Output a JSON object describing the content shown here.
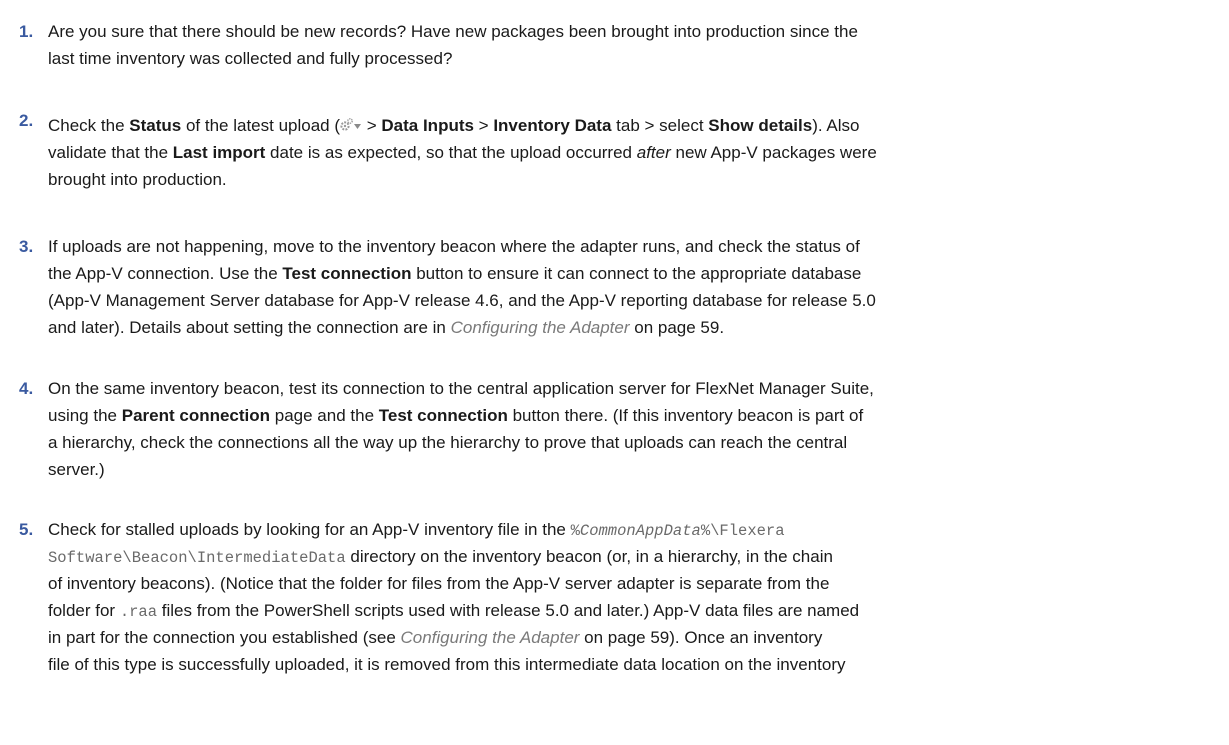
{
  "items": [
    {
      "num": "1.",
      "lines": [
        [
          {
            "t": "Are you sure that there should be new records? Have new packages been brought into production since the"
          }
        ],
        [
          {
            "t": "last time inventory was collected and fully processed?"
          }
        ]
      ]
    },
    {
      "num": "2.",
      "lines": [
        [
          {
            "t": "Check the "
          },
          {
            "t": "Status",
            "s": "b"
          },
          {
            "t": " of the latest upload ("
          },
          {
            "icon": "gear-dropdown-icon"
          },
          {
            "t": " > "
          },
          {
            "t": "Data Inputs",
            "s": "b"
          },
          {
            "t": " > "
          },
          {
            "t": "Inventory Data",
            "s": "b"
          },
          {
            "t": " tab > select "
          },
          {
            "t": "Show details",
            "s": "b"
          },
          {
            "t": "). Also"
          }
        ],
        [
          {
            "t": "validate that the "
          },
          {
            "t": "Last import",
            "s": "b"
          },
          {
            "t": " date is as expected, so that the upload occurred "
          },
          {
            "t": "after",
            "s": "i"
          },
          {
            "t": " new App-V packages were"
          }
        ],
        [
          {
            "t": "brought into production."
          }
        ]
      ]
    },
    {
      "num": "3.",
      "lines": [
        [
          {
            "t": "If uploads are not happening, move to the inventory beacon where the adapter runs, and check the status of"
          }
        ],
        [
          {
            "t": "the App-V connection. Use the "
          },
          {
            "t": "Test connection",
            "s": "b"
          },
          {
            "t": " button to ensure it can connect to the appropriate database"
          }
        ],
        [
          {
            "t": "(App-V Management Server database for App-V release 4.6, and the App-V reporting database for release 5.0"
          }
        ],
        [
          {
            "t": "and later). Details about setting the connection are in "
          },
          {
            "t": "Configuring the Adapter",
            "s": "x"
          },
          {
            "t": " on page 59."
          }
        ]
      ]
    },
    {
      "num": "4.",
      "lines": [
        [
          {
            "t": "On the same inventory beacon, test its connection to the central application server for FlexNet Manager Suite,"
          }
        ],
        [
          {
            "t": "using the "
          },
          {
            "t": "Parent connection",
            "s": "b"
          },
          {
            "t": " page and the "
          },
          {
            "t": "Test connection",
            "s": "b"
          },
          {
            "t": " button there. (If this inventory beacon is part of"
          }
        ],
        [
          {
            "t": "a hierarchy, check the connections all the way up the hierarchy to prove that uploads can reach the central"
          }
        ],
        [
          {
            "t": "server.)"
          }
        ]
      ]
    },
    {
      "num": "5.",
      "lines": [
        [
          {
            "t": "Check for stalled uploads by looking for an App-V inventory file in the "
          },
          {
            "t": "%",
            "s": "m"
          },
          {
            "t": "CommonAppData",
            "s": "mi"
          },
          {
            "t": "%\\Flexera",
            "s": "m"
          }
        ],
        [
          {
            "t": "Software\\Beacon\\IntermediateData",
            "s": "m"
          },
          {
            "t": " directory on the inventory beacon (or, in a hierarchy, in the chain"
          }
        ],
        [
          {
            "t": "of inventory beacons). (Notice that the folder for files from the App-V server adapter is separate from the"
          }
        ],
        [
          {
            "t": "folder for "
          },
          {
            "t": ".raa",
            "s": "m"
          },
          {
            "t": " files from the PowerShell scripts used with release 5.0 and later.) App-V data files are named"
          }
        ],
        [
          {
            "t": "in part for the connection you established (see "
          },
          {
            "t": "Configuring the Adapter",
            "s": "x"
          },
          {
            "t": " on page 59). Once an inventory"
          }
        ],
        [
          {
            "t": "file of this type is successfully uploaded, it is removed from this intermediate data location on the inventory"
          }
        ]
      ]
    }
  ]
}
